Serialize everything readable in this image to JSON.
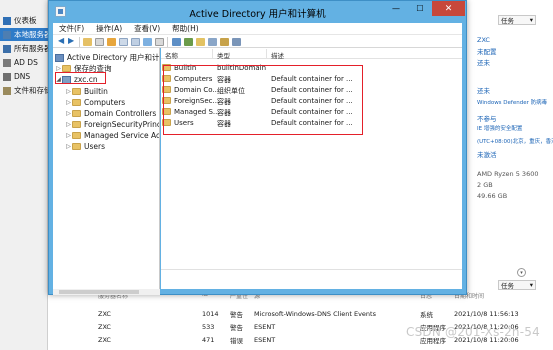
{
  "server_manager": {
    "nav": [
      {
        "label": "仪表板",
        "icon": "dashboard-icon"
      },
      {
        "label": "本地服务器",
        "icon": "local-server-icon"
      },
      {
        "label": "所有服务器",
        "icon": "all-servers-icon"
      },
      {
        "label": "AD DS",
        "icon": "ad-ds-icon"
      },
      {
        "label": "DNS",
        "icon": "dns-icon"
      },
      {
        "label": "文件和存储服务",
        "icon": "file-storage-icon"
      }
    ],
    "right_panel": {
      "tasks_label": "任务",
      "values": [
        {
          "text": "ZXC",
          "style": "link"
        },
        {
          "text": "未配置",
          "style": "link"
        },
        {
          "text": "还未",
          "style": "link"
        },
        {
          "text": "还未",
          "style": "link"
        },
        {
          "text": "Windows Defender 防病毒",
          "style": "link"
        },
        {
          "text": "不参与",
          "style": "link"
        },
        {
          "text": "IE 增强的安全配置",
          "style": "link"
        },
        {
          "text": "(UTC+08:00)北京，重庆，香港",
          "style": "link"
        },
        {
          "text": "未激活",
          "style": "link"
        },
        {
          "text": "AMD Ryzen 5 3600",
          "style": "gray"
        },
        {
          "text": "2 GB",
          "style": "gray"
        },
        {
          "text": "49.66 GB",
          "style": "gray"
        }
      ],
      "tasks2_label": "任务"
    },
    "events": {
      "headers": [
        "服务器名称",
        "ID",
        "严重性",
        "源",
        "日志",
        "日期和时间"
      ],
      "rows": [
        {
          "server": "ZXC",
          "id": "1014",
          "severity": "警告",
          "source": "Microsoft-Windows-DNS Client Events",
          "log": "系统",
          "datetime": "2021/10/8 11:56:13"
        },
        {
          "server": "ZXC",
          "id": "533",
          "severity": "警告",
          "source": "ESENT",
          "log": "应用程序",
          "datetime": "2021/10/8 11:20:06"
        },
        {
          "server": "ZXC",
          "id": "471",
          "severity": "错误",
          "source": "ESENT",
          "log": "应用程序",
          "datetime": "2021/10/8 11:20:06"
        }
      ]
    }
  },
  "aduc": {
    "title": "Active Directory 用户和计算机",
    "window_buttons": {
      "minimize": "—",
      "maximize": "☐",
      "close": "✕"
    },
    "menu": [
      "文件(F)",
      "操作(A)",
      "查看(V)",
      "帮助(H)"
    ],
    "tree": {
      "root": "Active Directory 用户和计算机",
      "saved_queries": "保存的查询",
      "domain": "zxc.cn",
      "children": [
        "Builtin",
        "Computers",
        "Domain Controllers",
        "ForeignSecurityPrincipals",
        "Managed Service Accounts",
        "Users"
      ]
    },
    "list": {
      "headers": {
        "name": "名称",
        "type": "类型",
        "description": "描述"
      },
      "rows": [
        {
          "name": "Builtin",
          "type": "builtinDomain",
          "description": ""
        },
        {
          "name": "Computers",
          "type": "容器",
          "description": "Default container for ..."
        },
        {
          "name": "Domain Co...",
          "type": "组织单位",
          "description": "Default container for ..."
        },
        {
          "name": "ForeignSec...",
          "type": "容器",
          "description": "Default container for ..."
        },
        {
          "name": "Managed S...",
          "type": "容器",
          "description": "Default container for ..."
        },
        {
          "name": "Users",
          "type": "容器",
          "description": "Default container for ..."
        }
      ]
    },
    "highlight_color": "#e4202a"
  },
  "watermark": "CSDN @201-Xs-2n-54"
}
